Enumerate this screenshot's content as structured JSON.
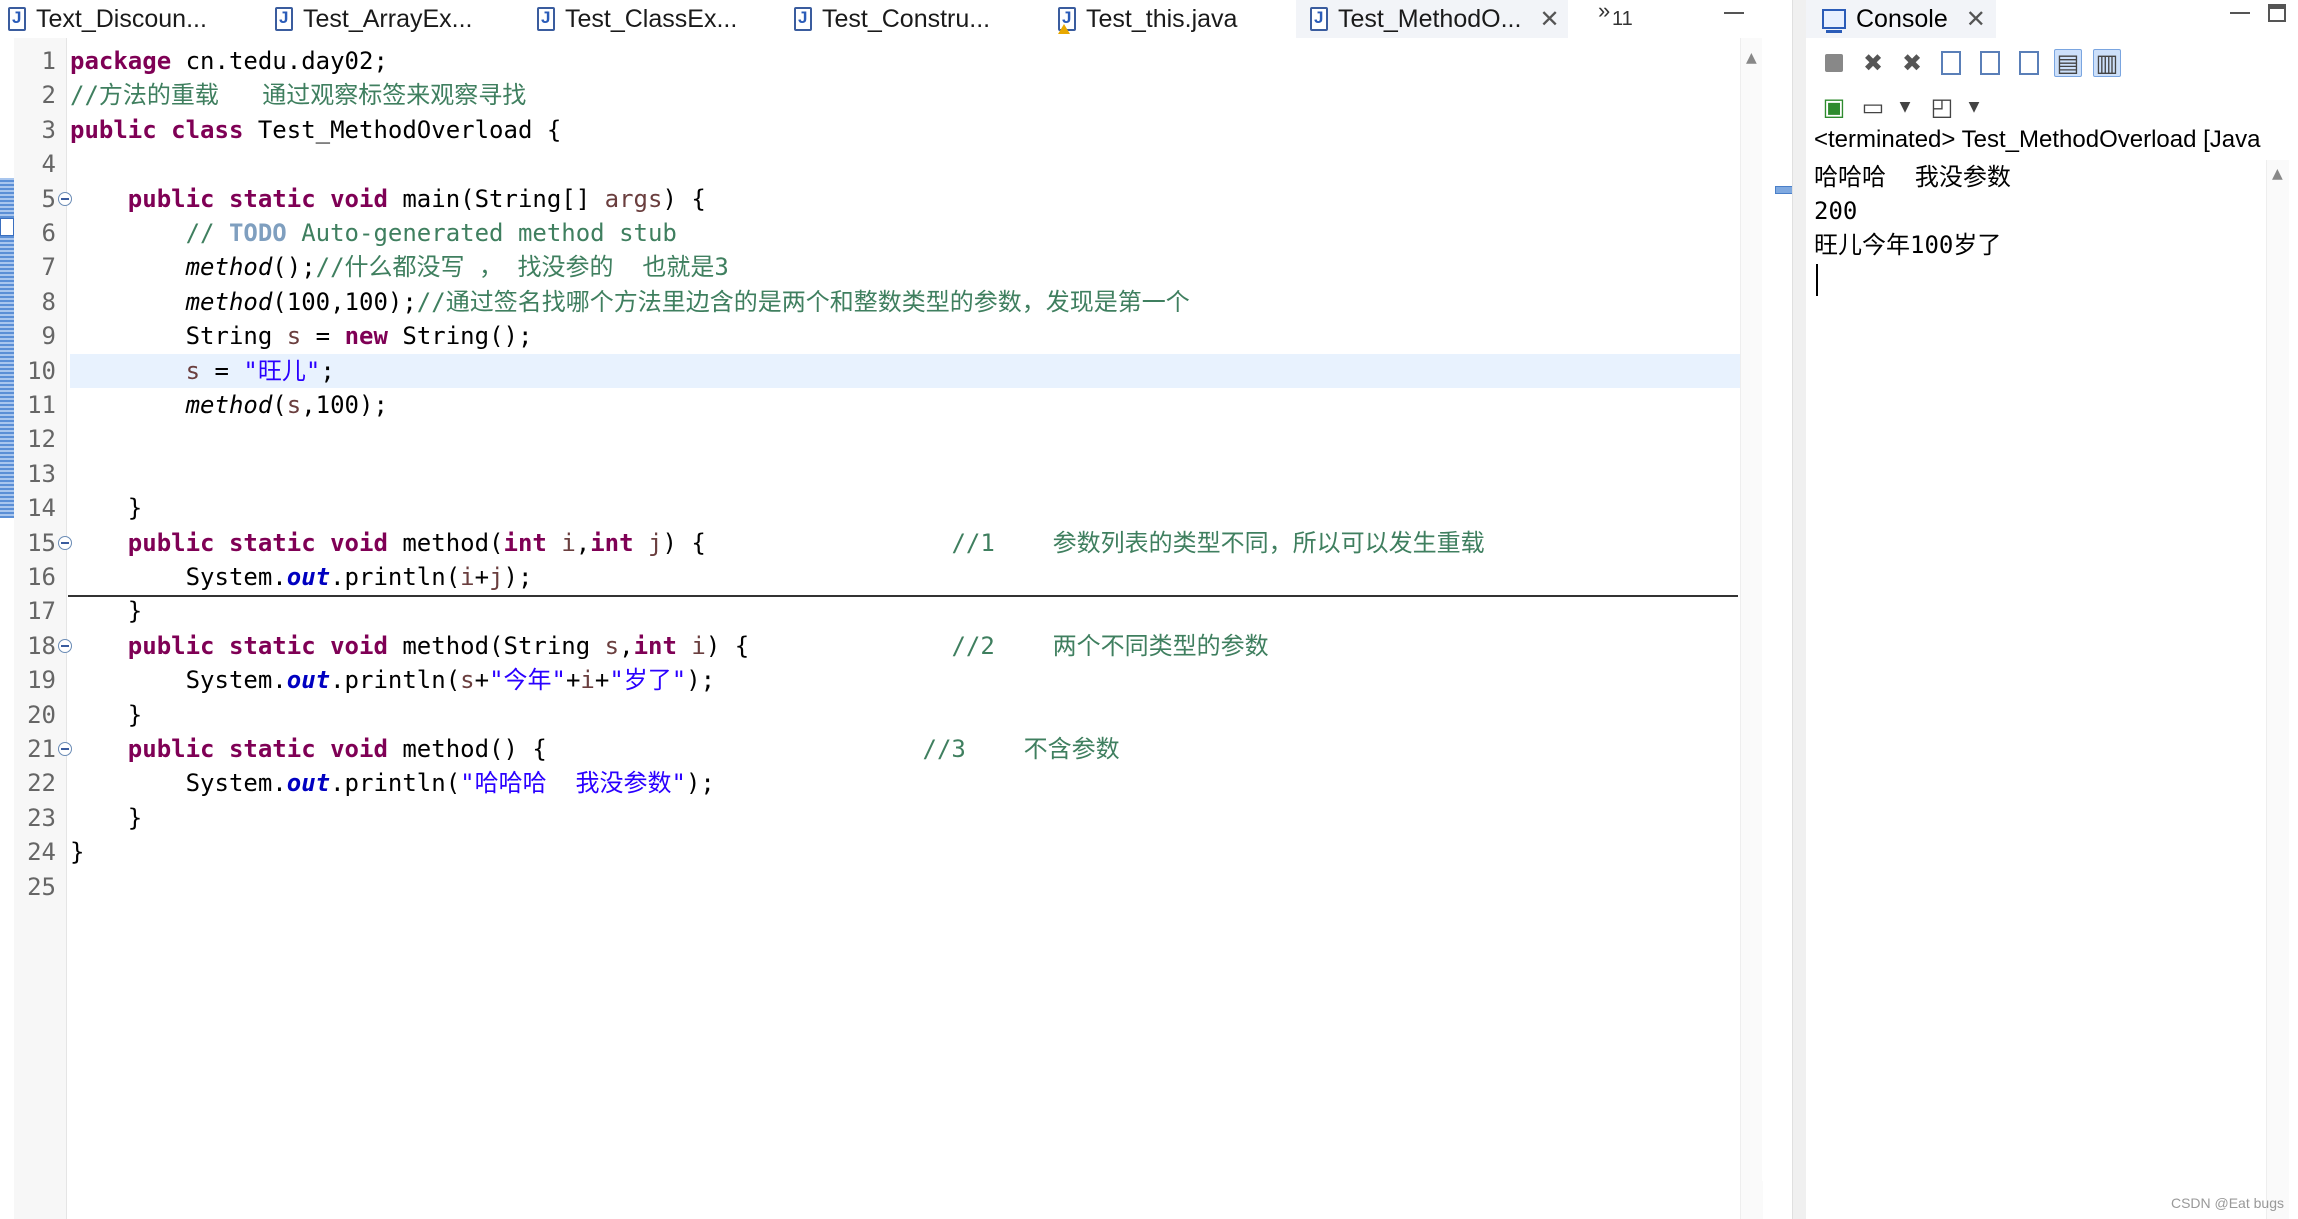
{
  "editor_tabs": [
    {
      "label": "Text_Discoun...",
      "active": false,
      "warning": false
    },
    {
      "label": "Test_ArrayEx...",
      "active": false,
      "warning": false
    },
    {
      "label": "Test_ClassEx...",
      "active": false,
      "warning": false
    },
    {
      "label": "Test_Constru...",
      "active": false,
      "warning": false
    },
    {
      "label": "Test_this.java",
      "active": false,
      "warning": true
    },
    {
      "label": "Test_MethodO...",
      "active": true,
      "warning": false
    }
  ],
  "tab_overflow": {
    "chevron": "»",
    "count": "11"
  },
  "editor": {
    "current_line": 10,
    "lines": [
      {
        "n": "1",
        "tokens": [
          {
            "t": "package",
            "c": "kw"
          },
          {
            "t": " cn.tedu.day02;"
          }
        ]
      },
      {
        "n": "2",
        "tokens": [
          {
            "t": "//方法的重载   通过观察标签来观察寻找",
            "c": "cm"
          }
        ]
      },
      {
        "n": "3",
        "tokens": [
          {
            "t": "public",
            "c": "kw"
          },
          {
            "t": " "
          },
          {
            "t": "class",
            "c": "kw"
          },
          {
            "t": " Test_MethodOverload {"
          }
        ]
      },
      {
        "n": "4",
        "tokens": []
      },
      {
        "n": "5",
        "fold": true,
        "tokens": [
          {
            "t": "    "
          },
          {
            "t": "public",
            "c": "kw"
          },
          {
            "t": " "
          },
          {
            "t": "static",
            "c": "kw"
          },
          {
            "t": " "
          },
          {
            "t": "void",
            "c": "kw"
          },
          {
            "t": " main(String[] "
          },
          {
            "t": "args",
            "c": "var"
          },
          {
            "t": ") {"
          }
        ]
      },
      {
        "n": "6",
        "tokens": [
          {
            "t": "        "
          },
          {
            "t": "// ",
            "c": "cm"
          },
          {
            "t": "TODO",
            "c": "todo"
          },
          {
            "t": " Auto-generated method stub",
            "c": "cm"
          }
        ]
      },
      {
        "n": "7",
        "tokens": [
          {
            "t": "        "
          },
          {
            "t": "method",
            "c": "it"
          },
          {
            "t": "();"
          },
          {
            "t": "//什么都没写 ， 找没参的  也就是3",
            "c": "cm"
          }
        ]
      },
      {
        "n": "8",
        "tokens": [
          {
            "t": "        "
          },
          {
            "t": "method",
            "c": "it"
          },
          {
            "t": "(100,100);"
          },
          {
            "t": "//通过签名找哪个方法里边含的是两个和整数类型的参数，发现是第一个",
            "c": "cm"
          }
        ]
      },
      {
        "n": "9",
        "tokens": [
          {
            "t": "        String "
          },
          {
            "t": "s",
            "c": "var"
          },
          {
            "t": " = "
          },
          {
            "t": "new",
            "c": "kw"
          },
          {
            "t": " String();"
          }
        ]
      },
      {
        "n": "10",
        "tokens": [
          {
            "t": "        "
          },
          {
            "t": "s",
            "c": "var"
          },
          {
            "t": " = "
          },
          {
            "t": "\"旺儿\"",
            "c": "st"
          },
          {
            "t": ";"
          }
        ]
      },
      {
        "n": "11",
        "tokens": [
          {
            "t": "        "
          },
          {
            "t": "method",
            "c": "it"
          },
          {
            "t": "("
          },
          {
            "t": "s",
            "c": "var"
          },
          {
            "t": ",100);"
          }
        ]
      },
      {
        "n": "12",
        "tokens": []
      },
      {
        "n": "13",
        "tokens": []
      },
      {
        "n": "14",
        "tokens": [
          {
            "t": "    }"
          }
        ]
      },
      {
        "n": "15",
        "fold": true,
        "tokens": [
          {
            "t": "    "
          },
          {
            "t": "public",
            "c": "kw"
          },
          {
            "t": " "
          },
          {
            "t": "static",
            "c": "kw"
          },
          {
            "t": " "
          },
          {
            "t": "void",
            "c": "kw"
          },
          {
            "t": " method("
          },
          {
            "t": "int",
            "c": "kw"
          },
          {
            "t": " "
          },
          {
            "t": "i",
            "c": "var"
          },
          {
            "t": ","
          },
          {
            "t": "int",
            "c": "kw"
          },
          {
            "t": " "
          },
          {
            "t": "j",
            "c": "var"
          },
          {
            "t": ") {                 "
          },
          {
            "t": "//1    参数列表的类型不同，所以可以发生重载",
            "c": "cm"
          }
        ]
      },
      {
        "n": "16",
        "tokens": [
          {
            "t": "        System."
          },
          {
            "t": "out",
            "c": "fld"
          },
          {
            "t": ".println("
          },
          {
            "t": "i",
            "c": "var"
          },
          {
            "t": "+"
          },
          {
            "t": "j",
            "c": "var"
          },
          {
            "t": ");"
          }
        ]
      },
      {
        "n": "17",
        "tokens": [
          {
            "t": "    }"
          }
        ]
      },
      {
        "n": "18",
        "fold": true,
        "tokens": [
          {
            "t": "    "
          },
          {
            "t": "public",
            "c": "kw"
          },
          {
            "t": " "
          },
          {
            "t": "static",
            "c": "kw"
          },
          {
            "t": " "
          },
          {
            "t": "void",
            "c": "kw"
          },
          {
            "t": " method(String "
          },
          {
            "t": "s",
            "c": "var"
          },
          {
            "t": ","
          },
          {
            "t": "int",
            "c": "kw"
          },
          {
            "t": " "
          },
          {
            "t": "i",
            "c": "var"
          },
          {
            "t": ") {              "
          },
          {
            "t": "//2    两个不同类型的参数",
            "c": "cm"
          }
        ]
      },
      {
        "n": "19",
        "tokens": [
          {
            "t": "        System."
          },
          {
            "t": "out",
            "c": "fld"
          },
          {
            "t": ".println("
          },
          {
            "t": "s",
            "c": "var"
          },
          {
            "t": "+"
          },
          {
            "t": "\"今年\"",
            "c": "st"
          },
          {
            "t": "+"
          },
          {
            "t": "i",
            "c": "var"
          },
          {
            "t": "+"
          },
          {
            "t": "\"岁了\"",
            "c": "st"
          },
          {
            "t": ");"
          }
        ]
      },
      {
        "n": "20",
        "tokens": [
          {
            "t": "    }"
          }
        ]
      },
      {
        "n": "21",
        "fold": true,
        "tokens": [
          {
            "t": "    "
          },
          {
            "t": "public",
            "c": "kw"
          },
          {
            "t": " "
          },
          {
            "t": "static",
            "c": "kw"
          },
          {
            "t": " "
          },
          {
            "t": "void",
            "c": "kw"
          },
          {
            "t": " method() {                          "
          },
          {
            "t": "//3    不含参数",
            "c": "cm"
          }
        ]
      },
      {
        "n": "22",
        "tokens": [
          {
            "t": "        System."
          },
          {
            "t": "out",
            "c": "fld"
          },
          {
            "t": ".println("
          },
          {
            "t": "\"哈哈哈  我没参数\"",
            "c": "st"
          },
          {
            "t": ");"
          }
        ]
      },
      {
        "n": "23",
        "tokens": [
          {
            "t": "    }"
          }
        ]
      },
      {
        "n": "24",
        "tokens": [
          {
            "t": "}"
          }
        ]
      },
      {
        "n": "25",
        "tokens": []
      }
    ]
  },
  "console": {
    "tab_label": "Console",
    "title": "<terminated> Test_MethodOverload [Java",
    "output": [
      "哈哈哈  我没参数",
      "200",
      "旺儿今年100岁了"
    ],
    "toolbar_icons": [
      "terminate-icon",
      "remove-launch-icon",
      "remove-all-terminated-icon",
      "clear-console-icon",
      "scroll-lock-icon",
      "word-wrap-icon",
      "show-on-stdout-icon",
      "show-on-stderr-icon"
    ],
    "toolbar2_icons": [
      "pin-console-icon",
      "display-selected-console-icon",
      "open-console-icon"
    ]
  },
  "watermark": "CSDN @Eat bugs"
}
